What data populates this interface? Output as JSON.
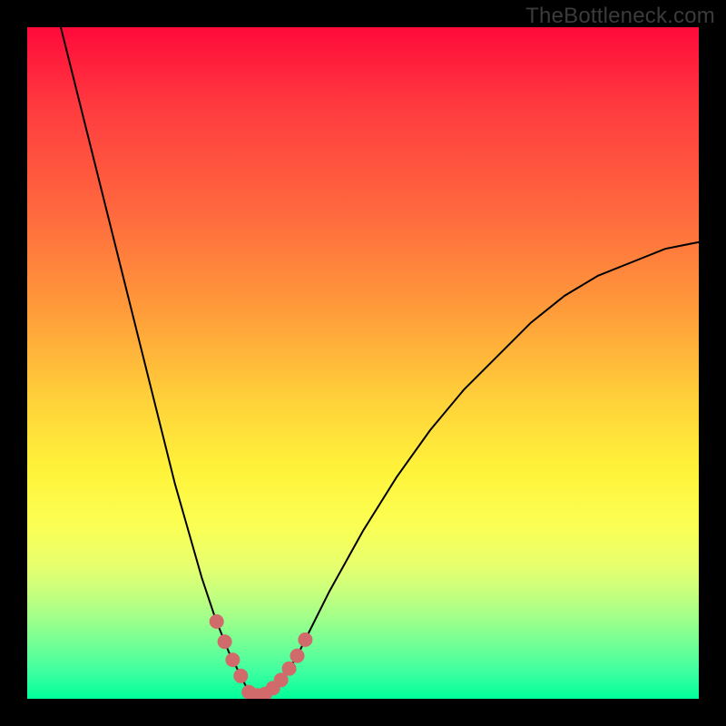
{
  "watermark": "TheBottleneck.com",
  "colors": {
    "curve": "#000000",
    "marker": "#d16a6a",
    "frame": "#000000"
  },
  "chart_data": {
    "type": "line",
    "title": "",
    "xlabel": "",
    "ylabel": "",
    "xlim": [
      0,
      100
    ],
    "ylim": [
      0,
      100
    ],
    "grid": false,
    "series": [
      {
        "name": "bottleneck-curve",
        "x": [
          5,
          10,
          15,
          20,
          22,
          24,
          26,
          28,
          30,
          31,
          32,
          33,
          34,
          35,
          36,
          38,
          40,
          42,
          45,
          50,
          55,
          60,
          65,
          70,
          75,
          80,
          85,
          90,
          95,
          100
        ],
        "y": [
          100,
          80,
          60,
          40,
          32,
          25,
          18,
          12,
          7,
          5,
          3,
          1,
          0.5,
          0.5,
          1,
          3,
          6,
          10,
          16,
          25,
          33,
          40,
          46,
          51,
          56,
          60,
          63,
          65,
          67,
          68
        ]
      }
    ],
    "highlight_band": {
      "x_start": 27,
      "x_end": 42,
      "threshold_y": 12
    }
  }
}
